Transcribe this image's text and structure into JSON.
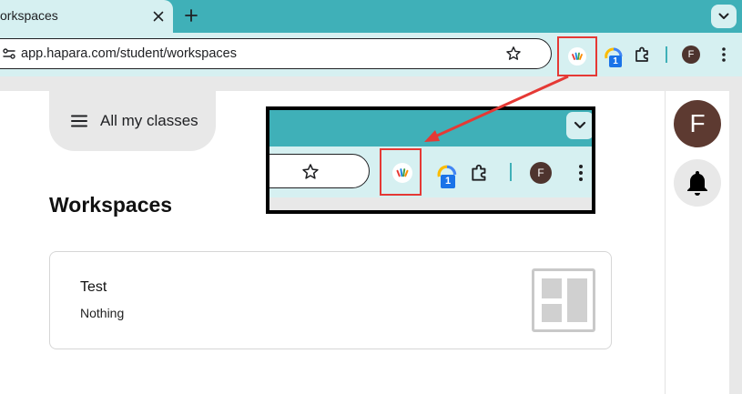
{
  "browser": {
    "tab_title": "orkspaces",
    "url": "app.hapara.com/student/workspaces",
    "extension_badge": "1",
    "profile_initial": "F"
  },
  "sidebar": {
    "classes_button_label": "All my classes"
  },
  "main": {
    "heading": "Workspaces",
    "workspaces": [
      {
        "title": "Test",
        "description": "Nothing"
      }
    ]
  },
  "rail": {
    "profile_initial": "F"
  },
  "colors": {
    "chrome_teal": "#3fb0b8",
    "toolbar": "#d6f0f1",
    "highlight_red": "#e53935",
    "profile_brown": "#5d3a31"
  },
  "icons": [
    "close-icon",
    "plus-icon",
    "chevron-down-icon",
    "site-settings-icon",
    "star-icon",
    "hapara-extension-icon",
    "google-extension-icon",
    "puzzle-icon",
    "kebab-menu-icon",
    "hamburger-icon",
    "layout-thumbnail-icon",
    "bell-icon"
  ]
}
